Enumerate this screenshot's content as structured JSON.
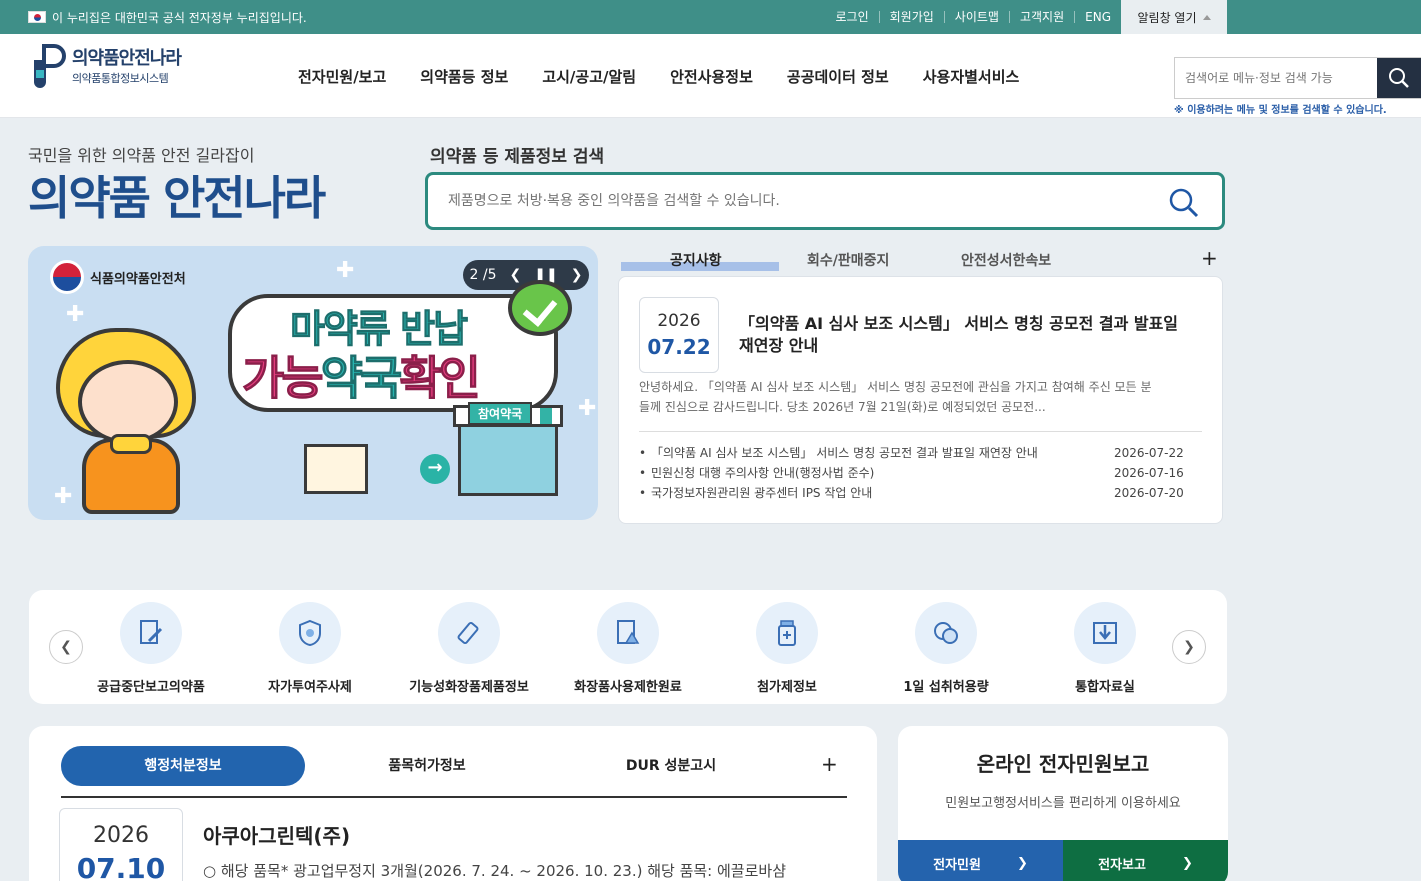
{
  "topbar": {
    "gov_notice": "이 누리집은 대한민국 공식 전자정부 누리집입니다.",
    "links": [
      "로그인",
      "회원가입",
      "사이트맵",
      "고객지원",
      "ENG"
    ],
    "alarm_label": "알림창 열기"
  },
  "header": {
    "logo_title": "의약품안전나라",
    "logo_subtitle": "의약품통합정보시스템",
    "nav": [
      "전자민원/보고",
      "의약품등 정보",
      "고시/공고/알림",
      "안전사용정보",
      "공공데이터 정보",
      "사용자별서비스"
    ],
    "search_placeholder": "검색어로 메뉴·정보 검색 가능",
    "search_note": "※ 이용하려는 메뉴 및 정보를 검색할 수 있습니다."
  },
  "hero": {
    "slogan": "국민을 위한 의약품 안전 길라잡이",
    "brand": "의약품 안전나라",
    "search_title": "의약품 등 제품정보 검색",
    "search_placeholder": "제품명으로 처방·복용 중인 의약품을 검색할 수 있습니다."
  },
  "banner": {
    "agency": "식품의약품안전처",
    "counter": "2 /5",
    "line1": "마약류 반납",
    "line2a": "가능",
    "line2b": "약국",
    "line2c": "확인",
    "pharmacy_label": "참여약국"
  },
  "notice": {
    "tabs": [
      "공지사항",
      "회수/판매중지",
      "안전성서한속보"
    ],
    "featured": {
      "year": "2026",
      "monthday": "07.22",
      "title": "「의약품 AI 심사 보조 시스템」 서비스 명칭 공모전 결과 발표일 재연장 안내",
      "summary": "안녕하세요. 「의약품 AI 심사 보조 시스템」 서비스 명칭 공모전에 관심을 가지고 참여해 주신 모든 분들께 진심으로 감사드립니다. 당초 2026년 7월 21일(화)로 예정되었던 공모전..."
    },
    "items": [
      {
        "title": "「의약품 AI 심사 보조 시스템」 서비스 명칭 공모전 결과 발표일 재연장 안내",
        "date": "2026-07-22"
      },
      {
        "title": "민원신청 대행 주의사항 안내(행정사법 준수)",
        "date": "2026-07-16"
      },
      {
        "title": "국가정보자원관리원 광주센터 IPS 작업 안내",
        "date": "2026-07-20"
      }
    ]
  },
  "quick_menu": [
    {
      "label": "공급중단보고의약품",
      "icon": "document-pen-icon"
    },
    {
      "label": "자가투여주사제",
      "icon": "shield-pill-icon"
    },
    {
      "label": "기능성화장품제품정보",
      "icon": "cosmetic-tube-icon"
    },
    {
      "label": "화장품사용제한원료",
      "icon": "warning-document-icon"
    },
    {
      "label": "첨가제정보",
      "icon": "medicine-bottle-icon"
    },
    {
      "label": "1일 섭취허용량",
      "icon": "capsule-icon"
    },
    {
      "label": "통합자료실",
      "icon": "download-box-icon"
    }
  ],
  "admin": {
    "tabs": [
      "행정처분정보",
      "품목허가정보",
      "DUR 성분고시"
    ],
    "year": "2026",
    "monthday": "07.10",
    "company": "아쿠아그린텍(주)",
    "desc": "○ 해당 품목* 광고업무정지 3개월(2026. 7. 24. ~ 2026. 10. 23.) 해당 품목: 에끌로바샴"
  },
  "civil": {
    "title": "온라인 전자민원보고",
    "subtitle": "민원보고행정서비스를 편리하게 이용하세요",
    "btn1": "전자민원",
    "btn2": "전자보고"
  }
}
